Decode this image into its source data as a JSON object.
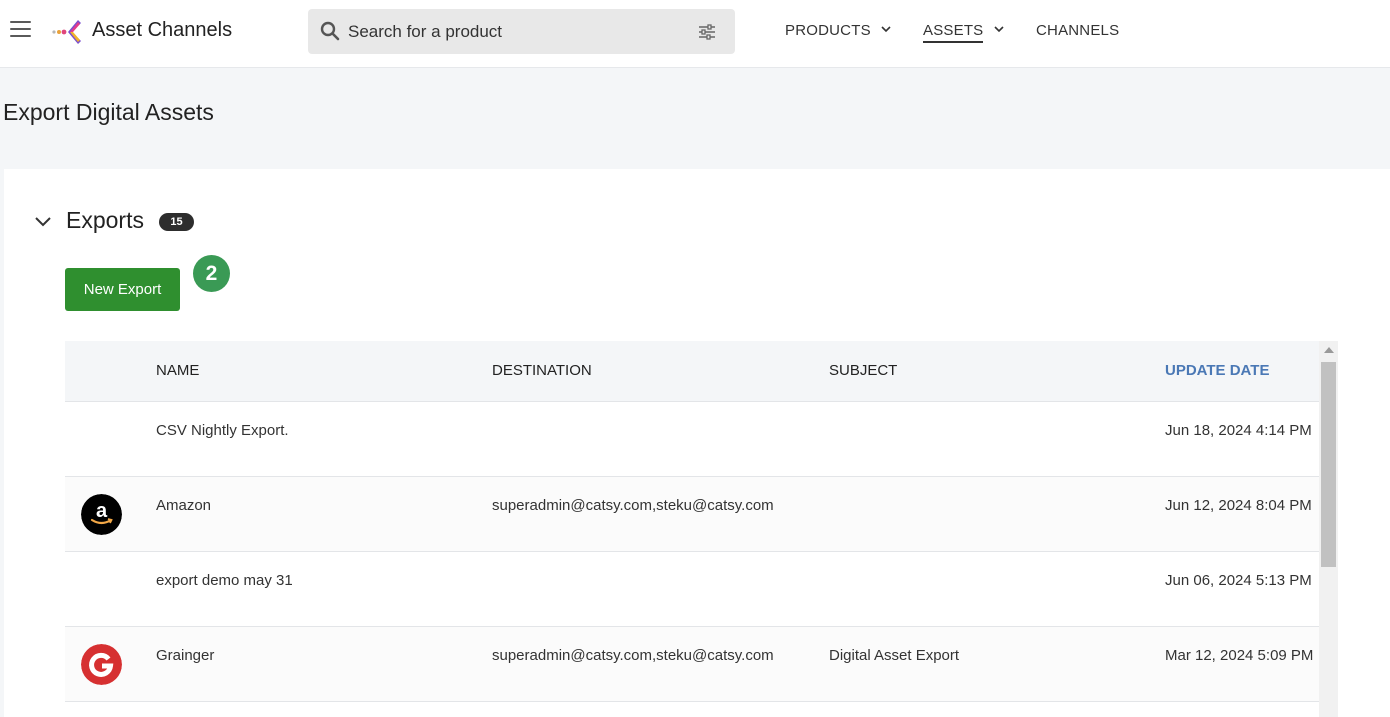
{
  "header": {
    "app_title": "Asset Channels",
    "search_placeholder": "Search for a product",
    "nav": [
      {
        "label": "PRODUCTS",
        "has_dropdown": true,
        "active": false
      },
      {
        "label": "ASSETS",
        "has_dropdown": true,
        "active": true
      },
      {
        "label": "CHANNELS",
        "has_dropdown": false,
        "active": false
      }
    ]
  },
  "page": {
    "title": "Export Digital Assets"
  },
  "exports": {
    "section_title": "Exports",
    "count": "15",
    "new_button_label": "New Export",
    "step_badge": "2",
    "columns": {
      "name": "NAME",
      "destination": "DESTINATION",
      "subject": "SUBJECT",
      "update_date": "UPDATE DATE"
    },
    "rows": [
      {
        "name": "CSV Nightly Export.",
        "destination": "",
        "subject": "",
        "update_date": "Jun 18, 2024 4:14 PM",
        "icon": ""
      },
      {
        "name": "Amazon",
        "destination": "superadmin@catsy.com,steku@catsy.com",
        "subject": "",
        "update_date": "Jun 12, 2024 8:04 PM",
        "icon": "amazon-logo-icon"
      },
      {
        "name": "export demo may 31",
        "destination": "",
        "subject": "",
        "update_date": "Jun 06, 2024 5:13 PM",
        "icon": ""
      },
      {
        "name": "Grainger",
        "destination": "superadmin@catsy.com,steku@catsy.com",
        "subject": "Digital Asset Export",
        "update_date": "Mar 12, 2024 5:09 PM",
        "icon": "grainger-logo-icon"
      }
    ]
  },
  "colors": {
    "primary_button": "#2f8f2f",
    "sort_header": "#4a78b5",
    "badge": "#2d2d2d",
    "step_badge": "#3a9a55"
  }
}
